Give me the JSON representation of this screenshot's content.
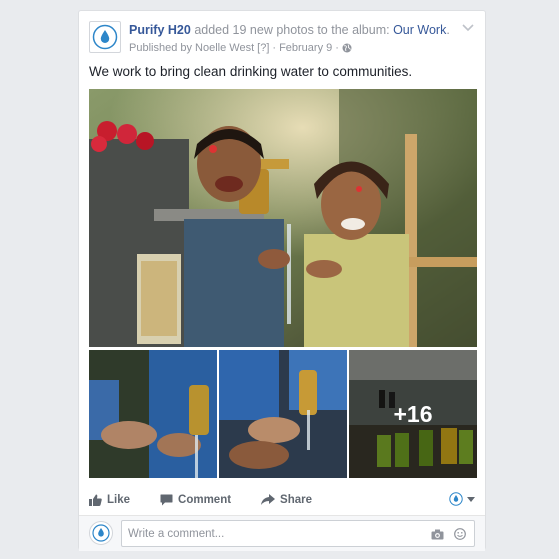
{
  "post": {
    "page_name": "Purify H20",
    "action_text": " added 19 new photos to the album: ",
    "album_name": "Our Work",
    "album_suffix": ".",
    "published_by": "Published by Noelle West",
    "help_marker": "[?]",
    "separator": "·",
    "date": "February 9",
    "text": "We work to bring clean drinking water to communities.",
    "more_photos": "+16"
  },
  "actions": {
    "like": "Like",
    "comment": "Comment",
    "share": "Share"
  },
  "comment_box": {
    "placeholder": "Write a comment..."
  },
  "icons": {
    "page_avatar": "water-drop-icon",
    "privacy": "globe-icon",
    "options": "chevron-down-icon",
    "like": "thumbs-up-icon",
    "comment": "speech-bubble-icon",
    "share": "share-arrow-icon",
    "camera": "camera-icon",
    "emoji": "smiley-icon"
  },
  "colors": {
    "brand_blue": "#365899",
    "drop_blue": "#2d86c9",
    "meta_gray": "#90949c",
    "action_gray": "#606770"
  }
}
